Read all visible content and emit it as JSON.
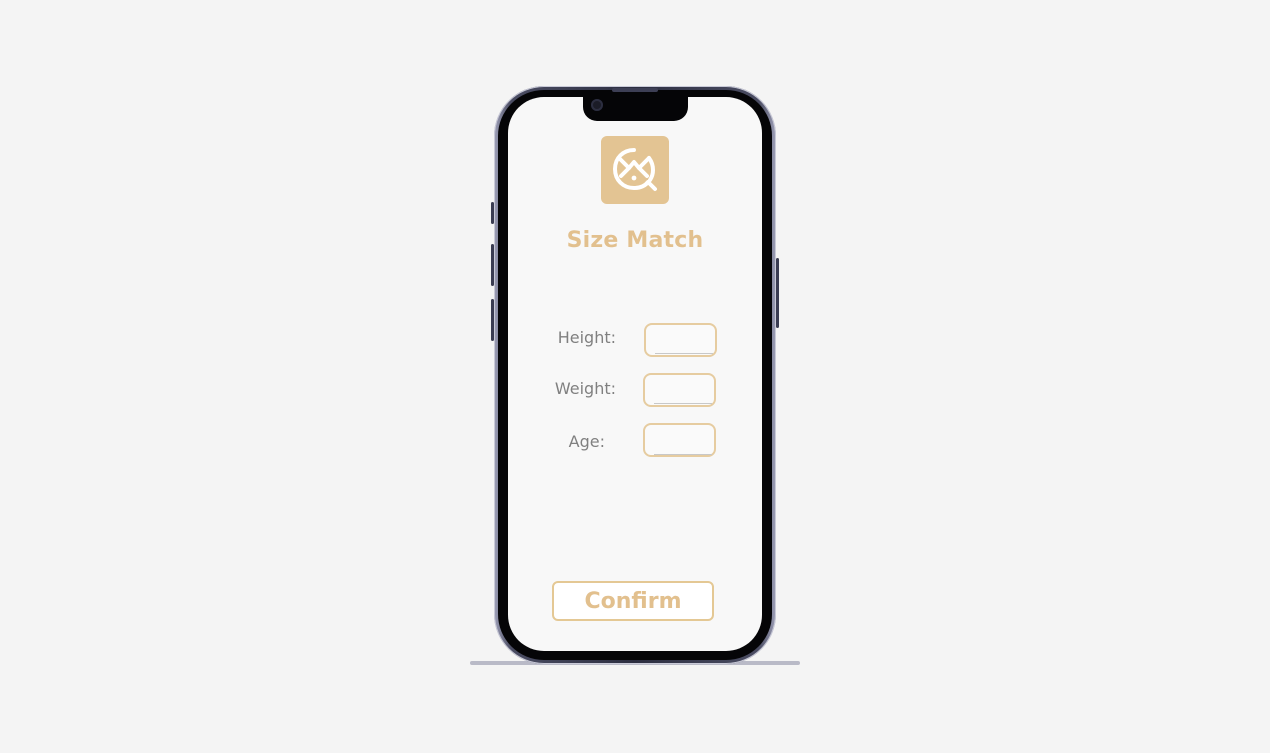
{
  "app": {
    "title": "Size Match",
    "logo_icon": "size-match-logo-icon",
    "brand_color": "#e3c493"
  },
  "form": {
    "fields": [
      {
        "label": "Height:",
        "value": ""
      },
      {
        "label": "Weight:",
        "value": ""
      },
      {
        "label": "Age:",
        "value": ""
      }
    ]
  },
  "actions": {
    "confirm_label": "Confirm"
  }
}
